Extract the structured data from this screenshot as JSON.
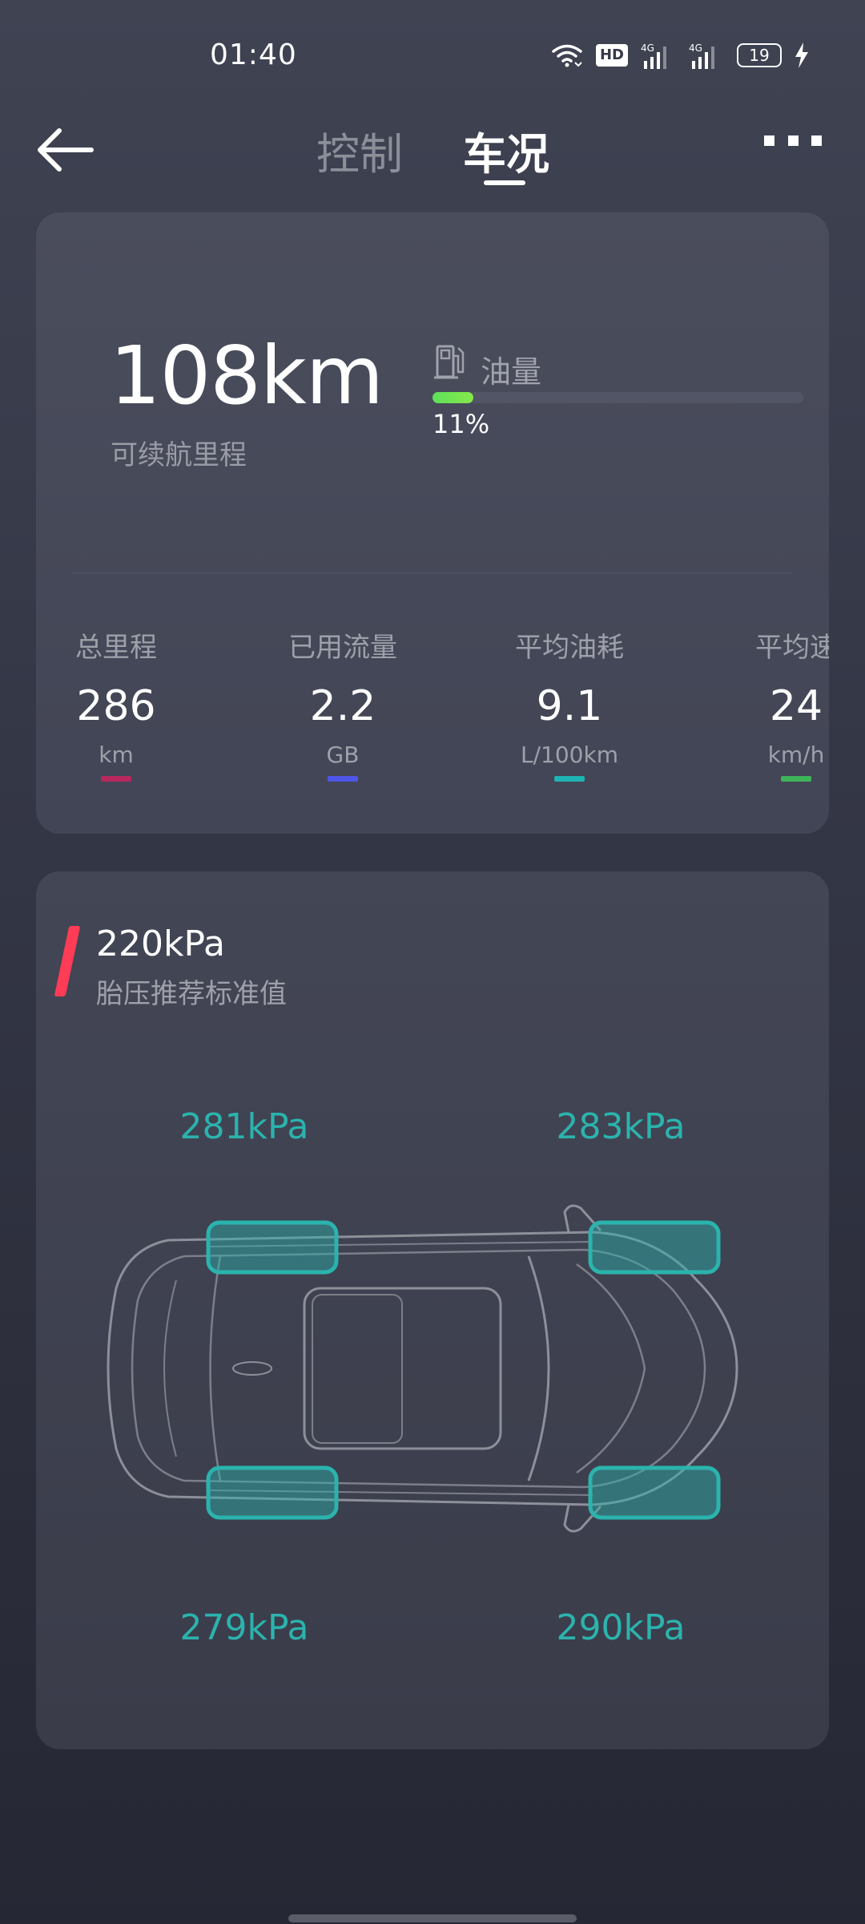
{
  "status_bar": {
    "time": "01:40",
    "hd_label": "HD",
    "network_1": "4G",
    "network_2": "4G",
    "battery": "19"
  },
  "nav": {
    "tab_control": "控制",
    "tab_status": "车况",
    "active_tab": "车况"
  },
  "overview": {
    "range_value": "108km",
    "range_label": "可续航里程",
    "fuel_label": "油量",
    "fuel_percent_text": "11%",
    "fuel_level": 0.11,
    "fuel_color": "#6ee351",
    "stats": [
      {
        "label": "总里程",
        "value": "286",
        "unit": "km",
        "color": "#b8285e"
      },
      {
        "label": "已用流量",
        "value": "2.2",
        "unit": "GB",
        "color": "#4f56e8"
      },
      {
        "label": "平均油耗",
        "value": "9.1",
        "unit": "L/100km",
        "color": "#1fb3b3"
      },
      {
        "label": "平均速",
        "value": "24",
        "unit": "km/h",
        "color": "#3fb35a"
      }
    ]
  },
  "tire": {
    "standard_value": "220kPa",
    "standard_label": "胎压推荐标准值",
    "accent_color": "#ff3c56",
    "tire_color": "#2bb3ad",
    "front_left": "281kPa",
    "front_right": "283kPa",
    "rear_left": "279kPa",
    "rear_right": "290kPa"
  }
}
